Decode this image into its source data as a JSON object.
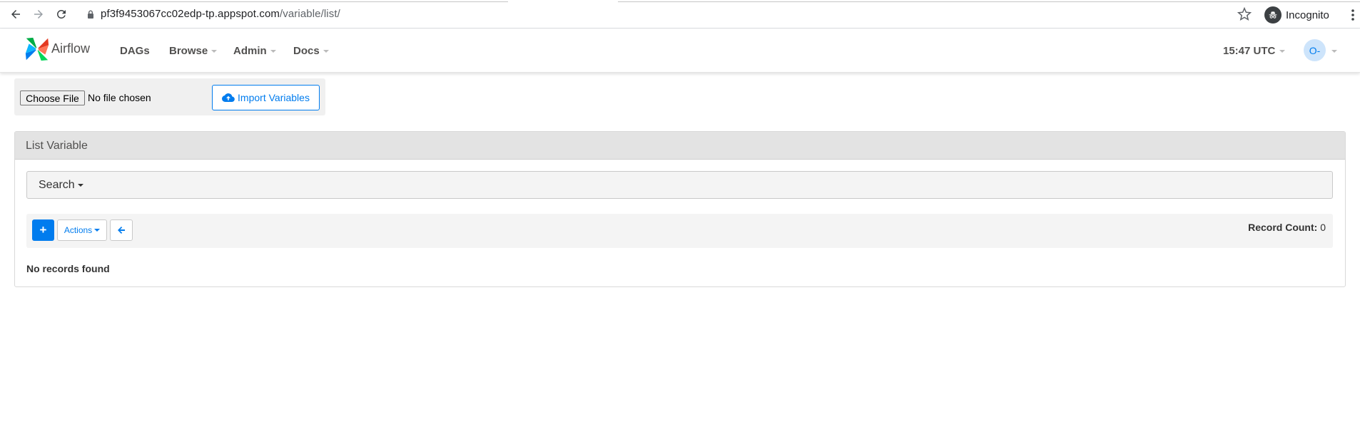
{
  "browser": {
    "url_host": "pf3f9453067cc02edp-tp.appspot.com",
    "url_path": "/variable/list/",
    "incognito_label": "Incognito",
    "icons": [
      "back-icon",
      "forward-icon",
      "reload-icon",
      "lock-icon",
      "star-icon",
      "incognito-icon",
      "kebab-menu-icon"
    ]
  },
  "navbar": {
    "brand": "Airflow",
    "items": [
      {
        "label": "DAGs",
        "has_caret": false
      },
      {
        "label": "Browse",
        "has_caret": true
      },
      {
        "label": "Admin",
        "has_caret": true
      },
      {
        "label": "Docs",
        "has_caret": true
      }
    ],
    "clock": "15:47 UTC",
    "avatar_initials": "O-"
  },
  "import": {
    "choose_file_label": "Choose File",
    "no_file_text": "No file chosen",
    "import_button_label": "Import Variables"
  },
  "panel": {
    "title": "List Variable",
    "search_label": "Search",
    "actions_label": "Actions",
    "record_count_label": "Record Count:",
    "record_count_value": "0",
    "empty_message": "No records found"
  },
  "colors": {
    "primary": "#017cee",
    "navbar_text": "#51504f",
    "panel_heading_bg": "#e3e3e3"
  }
}
